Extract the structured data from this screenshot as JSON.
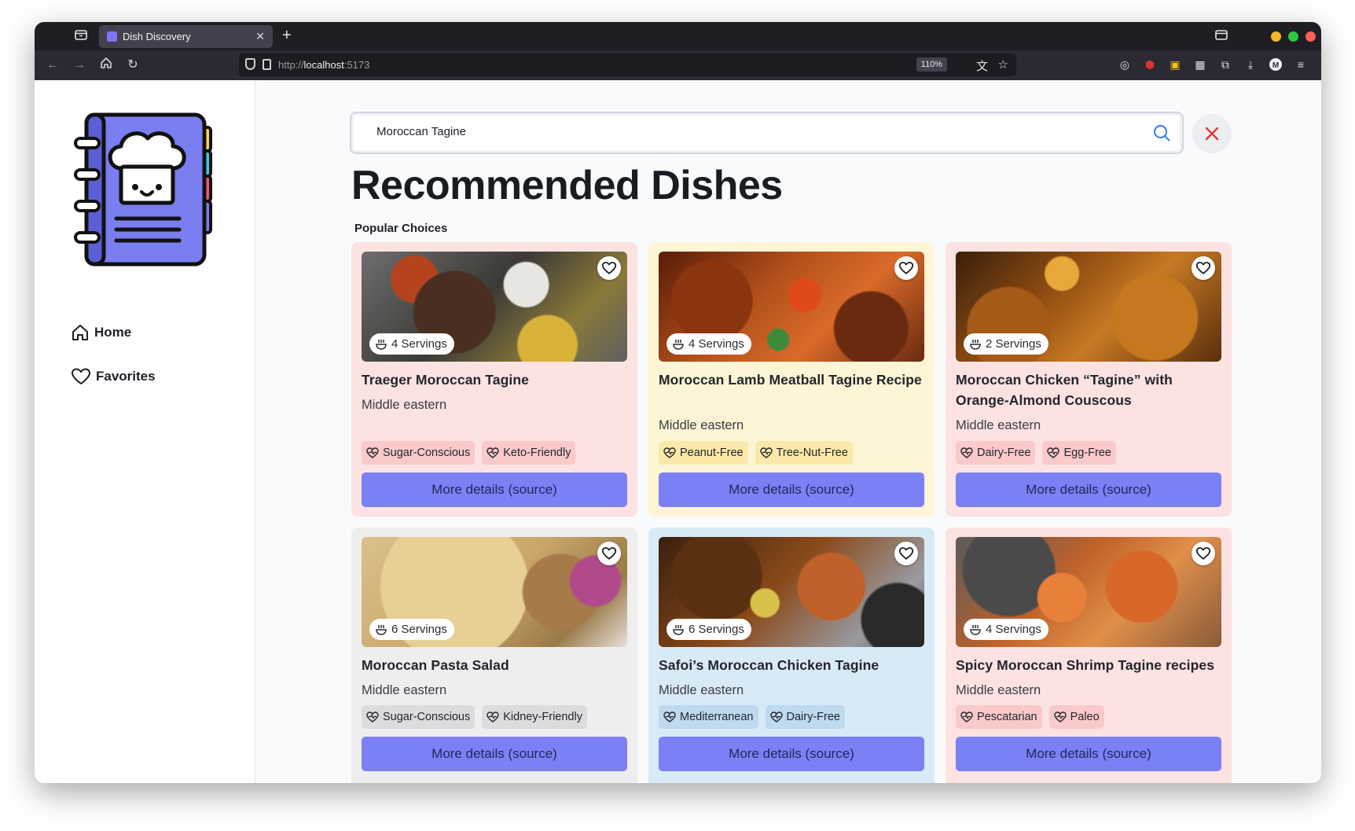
{
  "browser": {
    "tab_title": "Dish Discovery",
    "url_prefix": "http://",
    "url_host": "localhost",
    "url_port": ":5173",
    "zoom": "110%"
  },
  "sidebar": {
    "items": [
      {
        "label": "Home",
        "icon": "home-icon"
      },
      {
        "label": "Favorites",
        "icon": "heart-icon"
      }
    ]
  },
  "search": {
    "value": "Moroccan Tagine"
  },
  "page_title": "Recommended Dishes",
  "section_label": "Popular Choices",
  "details_label": "More details (source)",
  "colors": {
    "accent": "#7c80f5",
    "card_pink": "#fde2e2",
    "card_yellow": "#fdf5d5",
    "card_gray": "#eeeeef",
    "card_blue": "#d9eaf7",
    "tag_pink": "#fac9c9",
    "tag_yellow": "#fbe9a9",
    "tag_gray": "#dcdcdf",
    "tag_blue": "#bfd9ef"
  },
  "dishes": [
    {
      "title": "Traeger Moroccan Tagine",
      "cuisine": "Middle eastern",
      "servings": "4 Servings",
      "tags": [
        "Sugar-Conscious",
        "Keto-Friendly"
      ]
    },
    {
      "title": "Moroccan Lamb Meatball Tagine Recipe",
      "cuisine": "Middle eastern",
      "servings": "4 Servings",
      "tags": [
        "Peanut-Free",
        "Tree-Nut-Free"
      ]
    },
    {
      "title": "Moroccan Chicken “Tagine” with Orange-Almond Couscous",
      "cuisine": "Middle eastern",
      "servings": "2 Servings",
      "tags": [
        "Dairy-Free",
        "Egg-Free"
      ]
    },
    {
      "title": "Moroccan Pasta Salad",
      "cuisine": "Middle eastern",
      "servings": "6 Servings",
      "tags": [
        "Sugar-Conscious",
        "Kidney-Friendly"
      ]
    },
    {
      "title": "Safoi’s Moroccan Chicken Tagine",
      "cuisine": "Middle eastern",
      "servings": "6 Servings",
      "tags": [
        "Mediterranean",
        "Dairy-Free"
      ]
    },
    {
      "title": "Spicy Moroccan Shrimp Tagine recipes",
      "cuisine": "Middle eastern",
      "servings": "4 Servings",
      "tags": [
        "Pescatarian",
        "Paleo"
      ]
    }
  ]
}
